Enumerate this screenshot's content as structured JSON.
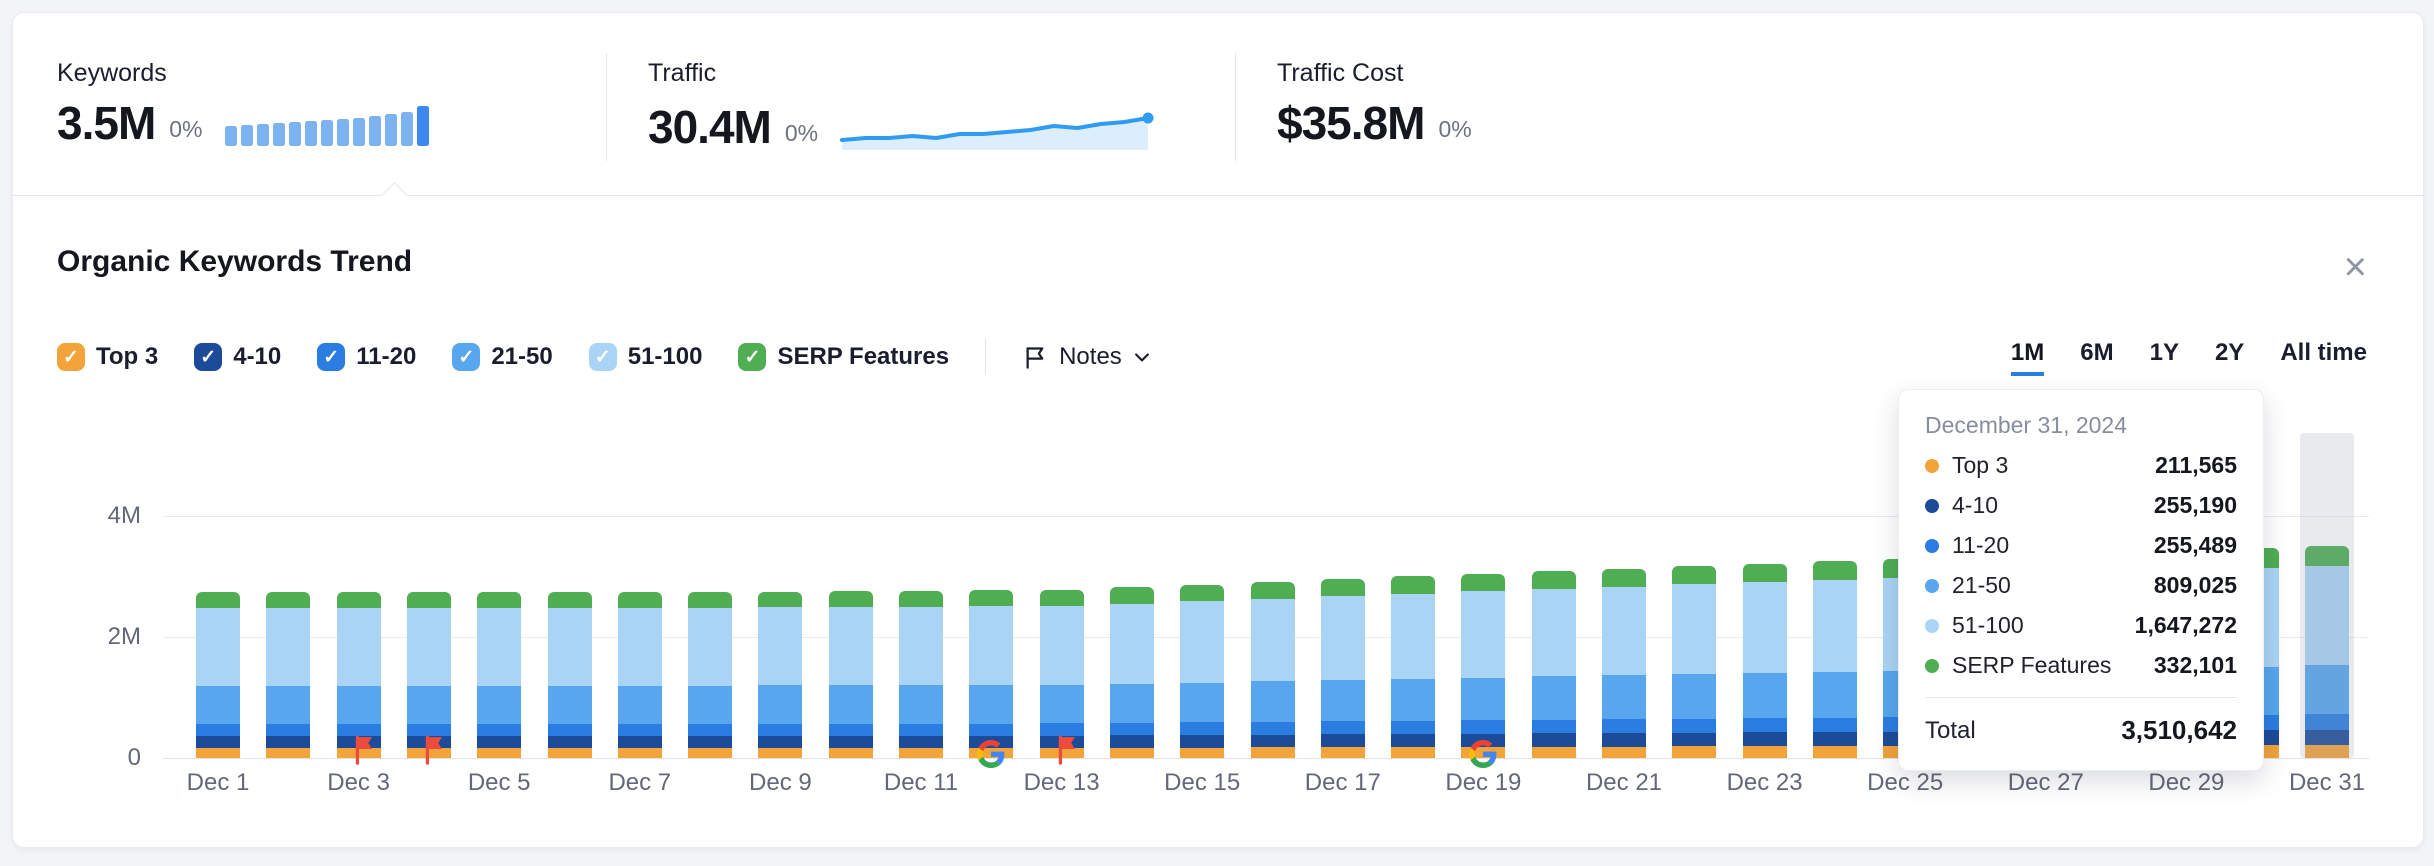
{
  "header": {
    "metrics": [
      {
        "id": "keywords",
        "label": "Keywords",
        "value": "3.5M",
        "change": "0%"
      },
      {
        "id": "traffic",
        "label": "Traffic",
        "value": "30.4M",
        "change": "0%"
      },
      {
        "id": "traffic_cost",
        "label": "Traffic Cost",
        "value": "$35.8M",
        "change": "0%"
      }
    ],
    "keywords_spark": {
      "values": [
        3.3,
        3.31,
        3.32,
        3.33,
        3.34,
        3.35,
        3.36,
        3.37,
        3.38,
        3.4,
        3.42,
        3.44,
        3.5
      ],
      "bar_color": "#7cb3ef",
      "last_bar_color": "#3e87ee"
    },
    "traffic_spark": {
      "values": [
        29.3,
        29.4,
        29.4,
        29.5,
        29.4,
        29.6,
        29.6,
        29.7,
        29.8,
        30.0,
        29.9,
        30.1,
        30.2,
        30.4
      ],
      "line_color": "#2f9bf1",
      "fill_color": "#dcedfc"
    }
  },
  "panel": {
    "title": "Organic Keywords Trend",
    "close_icon": "×"
  },
  "filters": {
    "check_glyph": "✓",
    "items": [
      {
        "label": "Top 3",
        "color": "#f2a33a",
        "checked": true
      },
      {
        "label": "4-10",
        "color": "#1c4b99",
        "checked": true
      },
      {
        "label": "11-20",
        "color": "#2a7de1",
        "checked": true
      },
      {
        "label": "21-50",
        "color": "#57a6ee",
        "checked": true
      },
      {
        "label": "51-100",
        "color": "#a9d4f5",
        "checked": true
      },
      {
        "label": "SERP Features",
        "color": "#4fae52",
        "checked": true
      }
    ]
  },
  "notes": {
    "label": "Notes"
  },
  "time_ranges": {
    "options": [
      "1M",
      "6M",
      "1Y",
      "2Y",
      "All time"
    ],
    "active": "1M"
  },
  "chart_data": {
    "type": "bar",
    "stacked": true,
    "title": "Organic Keywords Trend",
    "ylim": [
      0,
      4000000
    ],
    "y_ticks": [
      "0",
      "2M",
      "4M"
    ],
    "y_tick_values": [
      0,
      2000000,
      4000000
    ],
    "grid": true,
    "categories": [
      "Dec 1",
      "Dec 2",
      "Dec 3",
      "Dec 4",
      "Dec 5",
      "Dec 6",
      "Dec 7",
      "Dec 8",
      "Dec 9",
      "Dec 10",
      "Dec 11",
      "Dec 12",
      "Dec 13",
      "Dec 14",
      "Dec 15",
      "Dec 16",
      "Dec 17",
      "Dec 18",
      "Dec 19",
      "Dec 20",
      "Dec 21",
      "Dec 22",
      "Dec 23",
      "Dec 24",
      "Dec 25",
      "Dec 26",
      "Dec 27",
      "Dec 28",
      "Dec 29",
      "Dec 30",
      "Dec 31"
    ],
    "x_tick_labels": [
      "Dec 1",
      "Dec 3",
      "Dec 5",
      "Dec 7",
      "Dec 9",
      "Dec 11",
      "Dec 13",
      "Dec 15",
      "Dec 17",
      "Dec 19",
      "Dec 21",
      "Dec 23",
      "Dec 25",
      "Dec 27",
      "Dec 29",
      "Dec 31"
    ],
    "series": [
      {
        "name": "Top 3",
        "color": "#f2a33a",
        "values": [
          165000,
          165000,
          165000,
          165000,
          166000,
          165000,
          165000,
          166000,
          166000,
          166000,
          166000,
          167000,
          168000,
          170000,
          172000,
          175000,
          178000,
          181000,
          184000,
          186000,
          189000,
          191000,
          194000,
          196000,
          198000,
          200000,
          203000,
          205000,
          207000,
          209000,
          211565
        ]
      },
      {
        "name": "4-10",
        "color": "#1c4b99",
        "values": [
          199000,
          200000,
          199000,
          199000,
          200000,
          199000,
          199000,
          200000,
          200000,
          200000,
          201000,
          201000,
          202000,
          205000,
          208000,
          212000,
          215000,
          218000,
          222000,
          225000,
          228000,
          230000,
          233000,
          236000,
          239000,
          241000,
          244000,
          247000,
          249000,
          252000,
          255190
        ]
      },
      {
        "name": "11-20",
        "color": "#2a7de1",
        "values": [
          199000,
          200000,
          199000,
          200000,
          200000,
          200000,
          200000,
          200000,
          200000,
          201000,
          201000,
          202000,
          202000,
          205000,
          208000,
          212000,
          215000,
          218000,
          222000,
          225000,
          228000,
          231000,
          234000,
          237000,
          240000,
          242000,
          245000,
          248000,
          250000,
          253000,
          255489
        ]
      },
      {
        "name": "21-50",
        "color": "#57a6ee",
        "values": [
          631000,
          632000,
          631000,
          632000,
          633000,
          632000,
          632000,
          633000,
          634000,
          635000,
          636000,
          638000,
          640000,
          650000,
          659000,
          670000,
          682000,
          691000,
          703000,
          712000,
          721000,
          730000,
          740000,
          749000,
          758000,
          765000,
          774000,
          783000,
          790000,
          800000,
          809025
        ]
      },
      {
        "name": "51-100",
        "color": "#a9d4f5",
        "values": [
          1286000,
          1288000,
          1285000,
          1287000,
          1289000,
          1286000,
          1288000,
          1290000,
          1292000,
          1293000,
          1295000,
          1299000,
          1305000,
          1323000,
          1342000,
          1366000,
          1389000,
          1408000,
          1431000,
          1450000,
          1469000,
          1488000,
          1507000,
          1525000,
          1544000,
          1558000,
          1577000,
          1596000,
          1610000,
          1629000,
          1647272
        ]
      },
      {
        "name": "SERP Features",
        "color": "#4fae52",
        "values": [
          259000,
          260000,
          259000,
          259000,
          260000,
          259000,
          260000,
          260000,
          260000,
          261000,
          261000,
          262000,
          263000,
          267000,
          271000,
          275000,
          280000,
          284000,
          289000,
          292000,
          296000,
          300000,
          304000,
          307000,
          311000,
          314000,
          318000,
          322000,
          324000,
          328000,
          332101
        ]
      }
    ],
    "annotations": {
      "note_flags": [
        "Dec 3",
        "Dec 4",
        "Dec 13"
      ],
      "google_updates": [
        "Dec 12",
        "Dec 19"
      ],
      "highlighted_category": "Dec 31"
    },
    "legend_position": "top"
  },
  "tooltip": {
    "date": "December 31, 2024",
    "rows": [
      {
        "label": "Top 3",
        "value": "211,565",
        "color": "#f2a33a"
      },
      {
        "label": "4-10",
        "value": "255,190",
        "color": "#1c4b99"
      },
      {
        "label": "11-20",
        "value": "255,489",
        "color": "#2a7de1"
      },
      {
        "label": "21-50",
        "value": "809,025",
        "color": "#57a6ee"
      },
      {
        "label": "51-100",
        "value": "1,647,272",
        "color": "#a9d4f5"
      },
      {
        "label": "SERP Features",
        "value": "332,101",
        "color": "#4fae52"
      }
    ],
    "total_label": "Total",
    "total_value": "3,510,642"
  }
}
